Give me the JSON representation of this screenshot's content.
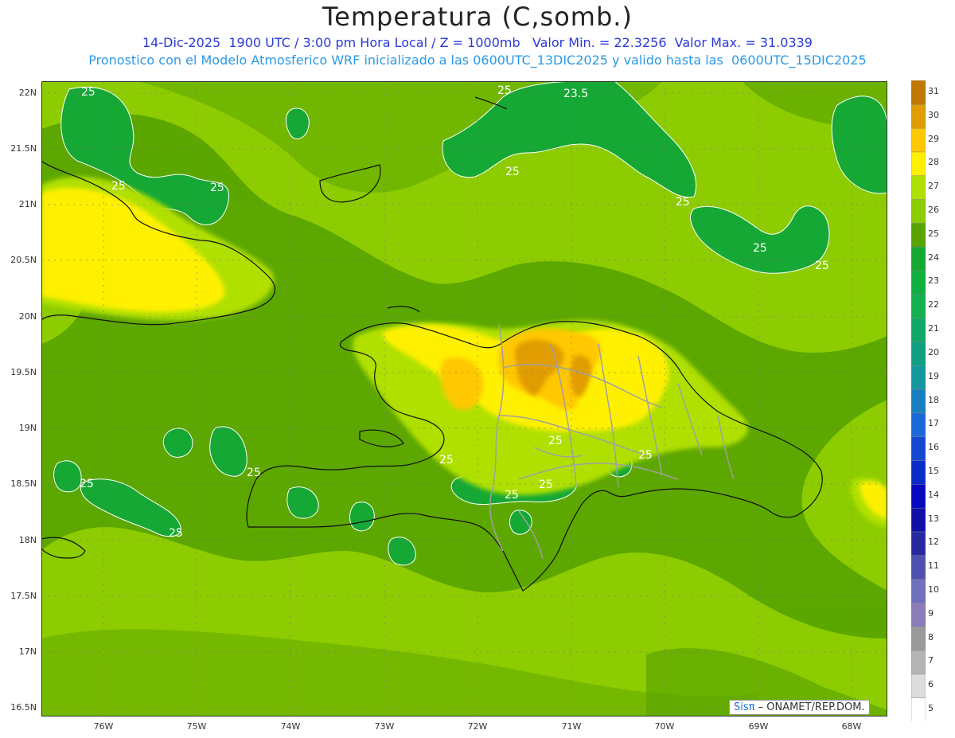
{
  "title": "Temperatura (C,somb.)",
  "subtitle_line1": "14-Dic-2025  1900 UTC / 3:00 pm Hora Local / Z = 1000mb   Valor Min. = 22.3256  Valor Max. = 31.0339",
  "subtitle_line2": "Pronostico con el Modelo Atmosferico WRF inicializado a las 0600UTC_13DIC2025 y valido hasta las  0600UTC_15DIC2025",
  "lat_labels": [
    "22N",
    "21.5N",
    "21N",
    "20.5N",
    "20N",
    "19.5N",
    "19N",
    "18.5N",
    "18N",
    "17.5N",
    "17N",
    "16.5N"
  ],
  "lon_labels": [
    "76W",
    "75W",
    "74W",
    "73W",
    "72W",
    "71W",
    "70W",
    "69W",
    "68W"
  ],
  "colorbar": {
    "levels": [
      "5",
      "6",
      "7",
      "8",
      "9",
      "10",
      "11",
      "12",
      "13",
      "14",
      "15",
      "16",
      "17",
      "18",
      "19",
      "20",
      "21",
      "22",
      "23",
      "24",
      "25",
      "26",
      "27",
      "28",
      "29",
      "30",
      "31"
    ],
    "colors": [
      "#ffffff",
      "#dcdcdc",
      "#b4b4b4",
      "#9a9a9a",
      "#8c7cb8",
      "#7070c0",
      "#5050b0",
      "#2828a0",
      "#1010a8",
      "#0808c0",
      "#0c2cc8",
      "#1448d0",
      "#1c68d8",
      "#1880c0",
      "#1498a0",
      "#10a080",
      "#10a868",
      "#14b050",
      "#10b040",
      "#16a834",
      "#5aa400",
      "#8ccc00",
      "#b0e000",
      "#fff000",
      "#ffc800",
      "#e09c00",
      "#c07800"
    ]
  },
  "contour_labels": [
    "25",
    "25",
    "25",
    "25",
    "25",
    "23.5",
    "25",
    "25",
    "25",
    "25",
    "25",
    "25",
    "25",
    "25",
    "25",
    "25",
    "25"
  ],
  "credit": {
    "sis": "Sisπ",
    "rest": " – ONAMET/REP.DOM."
  }
}
